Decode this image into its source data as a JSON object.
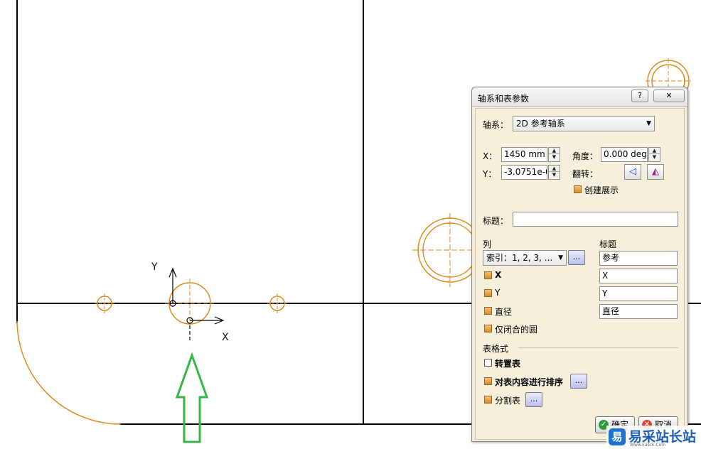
{
  "canvas": {
    "line_color": "#000000",
    "geometry_color": "#e08a1e",
    "arrow_color": "#3ab54a",
    "axis_labels": {
      "y": "Y",
      "x": "X"
    }
  },
  "dialog": {
    "title": "轴系和表参数",
    "help_label": "?",
    "close_label": "✕",
    "axis_system_label": "轴系：",
    "axis_system_value": "2D 参考轴系",
    "x_label": "X：",
    "x_value": "1450 mm",
    "y_label": "Y：",
    "y_value": "-3.0751e-0",
    "angle_label": "角度：",
    "angle_value": "0.000 deg",
    "flip_label": "翻转：",
    "create_view_label": "创建展示",
    "title_label": "标题：",
    "title_value": "",
    "columns_header": "列",
    "titles_header": "标题",
    "index_combo": "索引：1, 2, 3, ...",
    "index_title": "参考",
    "rows": [
      {
        "label": "X",
        "title": "X",
        "bold": true
      },
      {
        "label": "Y",
        "title": "Y",
        "bold": false
      },
      {
        "label": "直径",
        "title": "直径",
        "bold": false
      },
      {
        "label": "仅闭合的圆",
        "title": "",
        "bold": false
      }
    ],
    "table_format_label": "表格式",
    "transpose_label": "转置表",
    "sort_label": "对表内容进行排序",
    "split_label": "分割表",
    "ellipsis": "...",
    "ok_label": "确定",
    "cancel_label": "取消"
  },
  "watermark": {
    "logo_char": "易",
    "text": "易采站长站",
    "url": "Www.Easck.Com"
  }
}
